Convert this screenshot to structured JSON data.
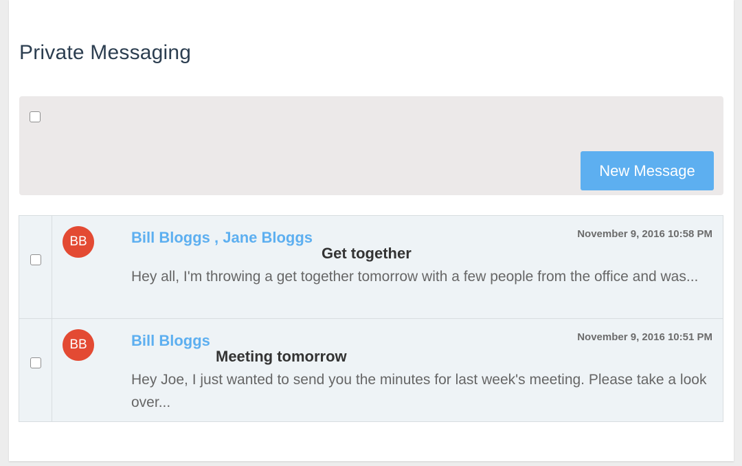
{
  "page": {
    "title": "Private Messaging"
  },
  "toolbar": {
    "new_message_label": "New Message"
  },
  "messages": [
    {
      "avatar_initials": "BB",
      "from": "Bill Bloggs , Jane Bloggs",
      "date": "November 9, 2016 10:58 PM",
      "subject": "Get together",
      "snippet": "Hey all, I'm throwing a get together tomorrow with a few people from the office and was..."
    },
    {
      "avatar_initials": "BB",
      "from": "Bill Bloggs",
      "date": "November 9, 2016 10:51 PM",
      "subject": "Meeting tomorrow",
      "snippet": "Hey Joe, I just wanted to send you the minutes for last week's meeting. Please take a look over..."
    }
  ],
  "colors": {
    "accent": "#5daff0",
    "avatar": "#e34a33",
    "toolbar_bg": "#ece9e9",
    "list_bg": "#eef3f6"
  }
}
